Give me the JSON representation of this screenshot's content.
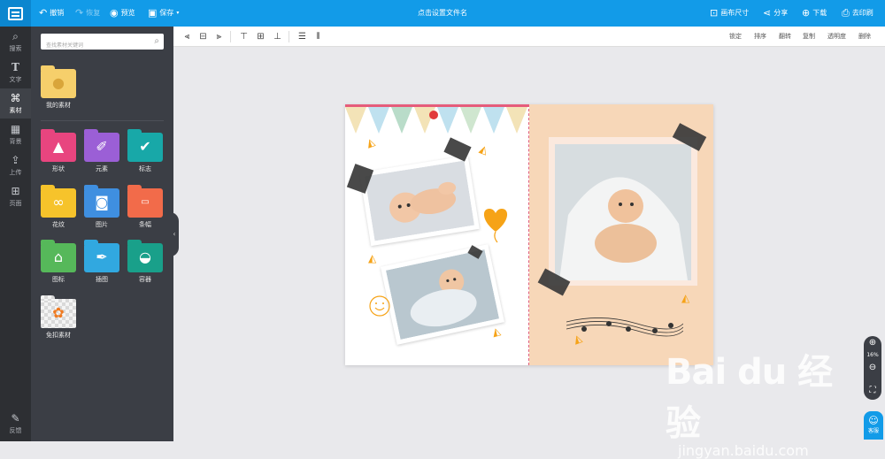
{
  "topbar": {
    "undo": "撤销",
    "redo": "恢复",
    "preview": "预览",
    "save": "保存",
    "doc_title": "点击设置文件名",
    "canvas_size": "画布尺寸",
    "share": "分享",
    "download": "下载",
    "print": "去印刷"
  },
  "iconbar": [
    {
      "label": "搜索",
      "icon": "search-icon"
    },
    {
      "label": "文字",
      "icon": "text-icon"
    },
    {
      "label": "素材",
      "icon": "material-icon"
    },
    {
      "label": "背景",
      "icon": "background-icon"
    },
    {
      "label": "上传",
      "icon": "upload-icon"
    },
    {
      "label": "页面",
      "icon": "page-icon"
    },
    {
      "label": "反馈",
      "icon": "feedback-icon"
    }
  ],
  "panel": {
    "search_placeholder": "查找素材关键词",
    "my_material": "我的素材",
    "tiles": [
      {
        "label": "形状",
        "color": "#e8457f"
      },
      {
        "label": "元素",
        "color": "#9b5fd6"
      },
      {
        "label": "标志",
        "color": "#18a8a8"
      },
      {
        "label": "花纹",
        "color": "#f6c32b"
      },
      {
        "label": "图片",
        "color": "#3f8fe0"
      },
      {
        "label": "条幅",
        "color": "#f26b4a"
      },
      {
        "label": "图标",
        "color": "#56b85a"
      },
      {
        "label": "插图",
        "color": "#31a8e0"
      },
      {
        "label": "容器",
        "color": "#19a08a"
      },
      {
        "label": "免扣素材",
        "color": "#dcdcdc"
      }
    ]
  },
  "toolbar2": {
    "lock": "锁定",
    "order": "排序",
    "flip": "翻转",
    "copy": "复制",
    "opacity": "透明度",
    "delete": "删除"
  },
  "zoom": {
    "value": "16%"
  },
  "help": {
    "label": "客服"
  },
  "watermark": {
    "brand": "Bai du 经验",
    "url": "jingyan.baidu.com"
  }
}
